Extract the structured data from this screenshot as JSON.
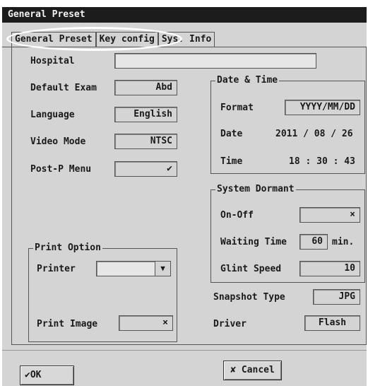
{
  "window": {
    "title": "General Preset"
  },
  "tabs": [
    {
      "label": "General Preset"
    },
    {
      "label": "Key config"
    },
    {
      "label": "Sys. Info"
    }
  ],
  "left": {
    "hospital": {
      "label": "Hospital",
      "value": ""
    },
    "default_exam": {
      "label": "Default Exam",
      "value": "Abd"
    },
    "language": {
      "label": "Language",
      "value": "English"
    },
    "video_mode": {
      "label": "Video Mode",
      "value": "NTSC"
    },
    "post_p_menu": {
      "label": "Post-P Menu",
      "value": "✔"
    }
  },
  "date_time": {
    "title": "Date & Time",
    "format_label": "Format",
    "format_value": "YYYY/MM/DD",
    "date_label": "Date",
    "date_value": "2011 / 08 / 26",
    "time_label": "Time",
    "time_value": "18 : 30 : 43"
  },
  "system_dormant": {
    "title": "System Dormant",
    "onoff_label": "On-Off",
    "onoff_value": "×",
    "waiting_label": "Waiting Time",
    "waiting_value": "60",
    "waiting_unit": "min.",
    "glint_label": "Glint Speed",
    "glint_value": "10"
  },
  "snapshot": {
    "label": "Snapshot Type",
    "value": "JPG"
  },
  "driver": {
    "label": "Driver",
    "value": "Flash"
  },
  "print_option": {
    "title": "Print Option",
    "printer_label": "Printer",
    "printer_value": "",
    "print_image_label": "Print Image",
    "print_image_value": "×"
  },
  "buttons": {
    "ok": "OK",
    "ok_icon": "✔",
    "cancel": "Cancel",
    "cancel_icon": "✘"
  }
}
